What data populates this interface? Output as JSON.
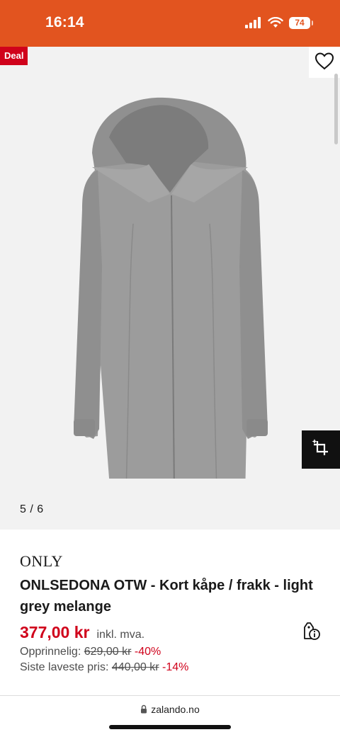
{
  "status_bar": {
    "time": "16:14",
    "battery_level": "74",
    "icons": [
      "signal-icon",
      "wifi-icon",
      "battery-icon"
    ],
    "background_color": "#e2541f"
  },
  "gallery": {
    "deal_badge": "Deal",
    "image_counter": "5 / 6",
    "wishlist_icon": "heart-outline-icon",
    "similar_icon": "crop-sparkle-icon",
    "background_color": "#f2f2f2"
  },
  "product": {
    "brand": "ONLY",
    "title": "ONLSEDONA OTW - Kort kåpe / frakk - light grey melange",
    "current_price": "377,00 kr",
    "vat_note": "inkl. mva.",
    "original_label": "Opprinnelig:",
    "original_price": "629,00 kr",
    "original_discount": "-40%",
    "lowest_label": "Siste laveste pris:",
    "lowest_price": "440,00 kr",
    "lowest_discount": "-14%",
    "price_info_icon": "price-tag-info-icon",
    "price_color": "#d0021b"
  },
  "browser": {
    "url": "zalando.no",
    "lock_icon": "lock-icon"
  }
}
